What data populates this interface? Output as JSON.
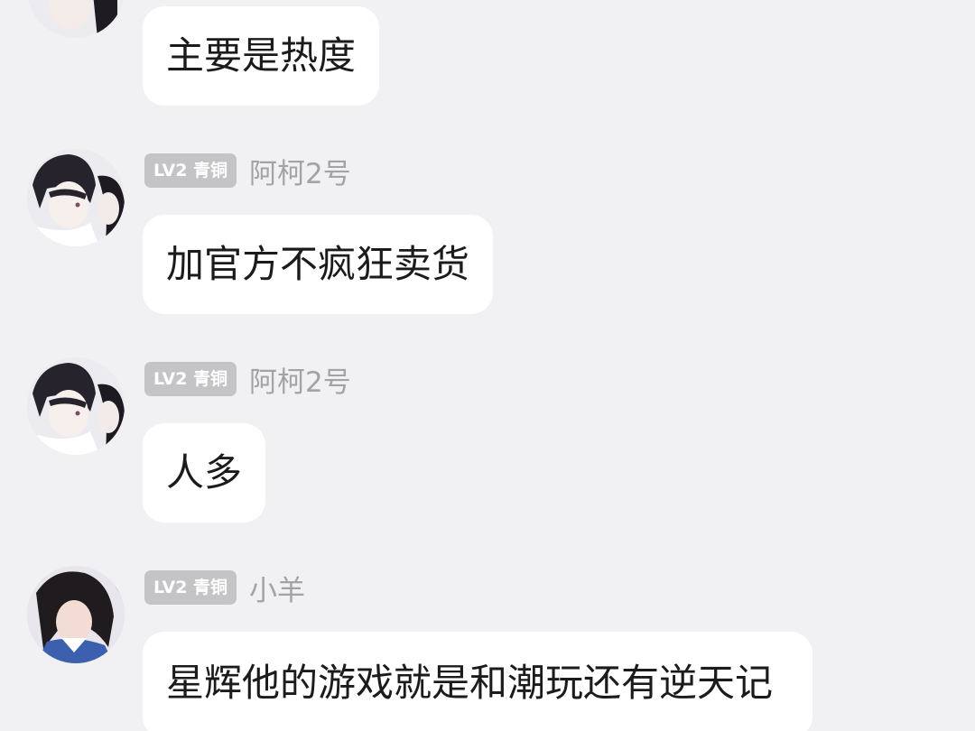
{
  "messages": [
    {
      "badge": "",
      "username": "",
      "text": "主要是热度"
    },
    {
      "badge": "LV2 青铜",
      "username": "阿柯2号",
      "text": "加官方不疯狂卖货"
    },
    {
      "badge": "LV2 青铜",
      "username": "阿柯2号",
      "text": "人多"
    },
    {
      "badge": "LV2 青铜",
      "username": "小羊",
      "text": "星辉他的游戏就是和潮玩还有逆天记"
    }
  ]
}
